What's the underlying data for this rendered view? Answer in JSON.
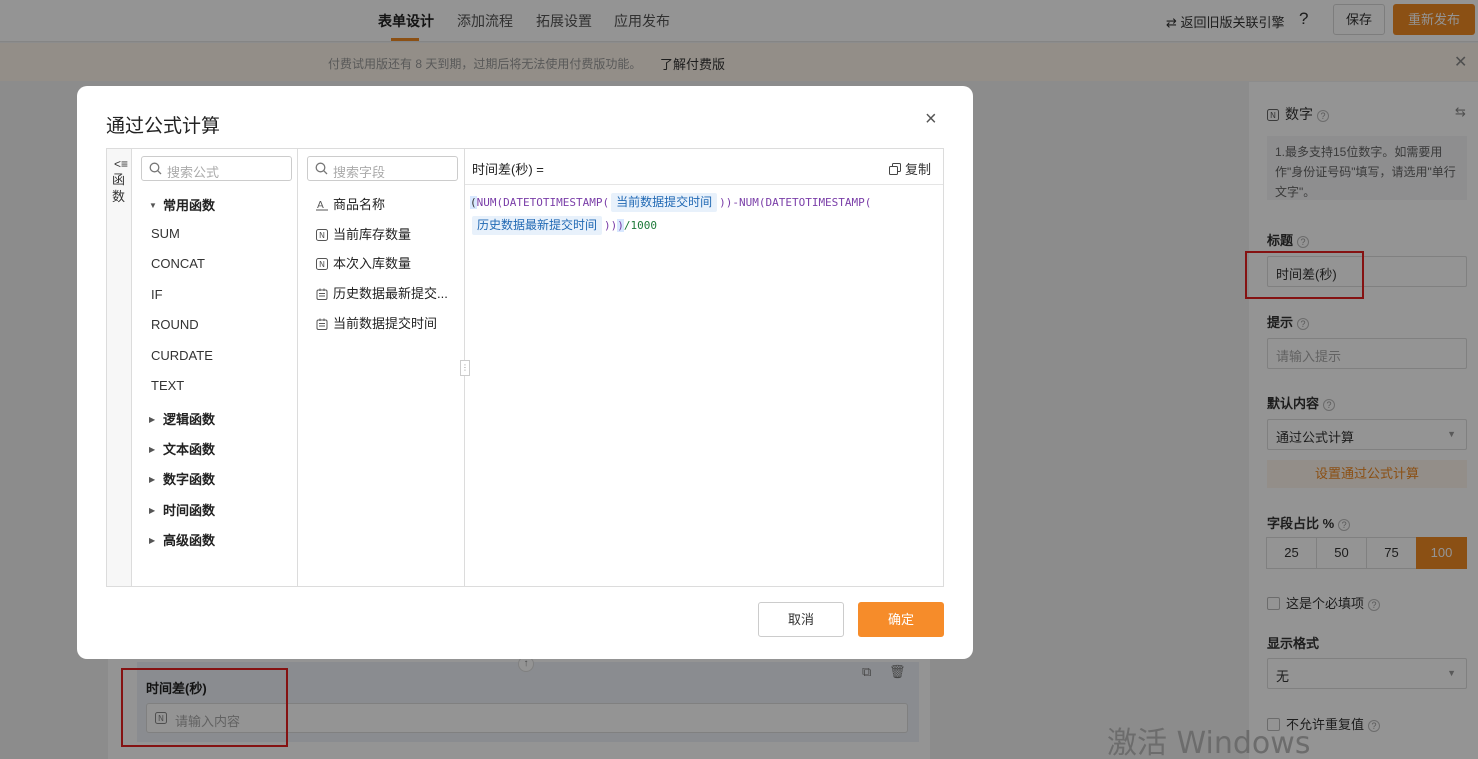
{
  "topbar": {
    "tabs": [
      "表单设计",
      "添加流程",
      "拓展设置",
      "应用发布"
    ],
    "back_link": "⇄ 返回旧版关联引擎",
    "help": "?",
    "save": "保存",
    "publish": "重新发布"
  },
  "banner": {
    "text": "付费试用版还有 8 天到期，过期后将无法使用付费版功能。",
    "link": "了解付费版",
    "close": "✕"
  },
  "canvas": {
    "field_label": "时间差(秒)",
    "field_placeholder": "请输入内容"
  },
  "panel": {
    "type_title": "数字",
    "description": "1.最多支持15位数字。如需要用作\"身份证号码\"填写，请选用\"单行文字\"。",
    "title_label": "标题",
    "title_value": "时间差(秒)",
    "hint_label": "提示",
    "hint_placeholder": "请输入提示",
    "default_label": "默认内容",
    "default_value": "通过公式计算",
    "formula_button": "设置通过公式计算",
    "ratio_label": "字段占比 %",
    "ratio_options": [
      "25",
      "50",
      "75",
      "100"
    ],
    "ratio_selected": "100",
    "required_label": "这是个必填项",
    "format_label": "显示格式",
    "format_value": "无",
    "no_duplicate_label": "不允许重复值"
  },
  "watermark": "激活 Windows",
  "modal": {
    "title": "通过公式计算",
    "close": "×",
    "side_tab": {
      "arrow": "<≡",
      "label": "函数"
    },
    "func_search_placeholder": "搜索公式",
    "field_search_placeholder": "搜索字段",
    "common_group": "常用函数",
    "common_functions": [
      "SUM",
      "CONCAT",
      "IF",
      "ROUND",
      "CURDATE",
      "TEXT"
    ],
    "groups": [
      "逻辑函数",
      "文本函数",
      "数字函数",
      "时间函数",
      "高级函数"
    ],
    "fields": [
      {
        "label": "商品名称",
        "icon": "text-field-icon"
      },
      {
        "label": "当前库存数量",
        "icon": "number-field-icon"
      },
      {
        "label": "本次入库数量",
        "icon": "number-field-icon"
      },
      {
        "label": "历史数据最新提交...",
        "icon": "date-field-icon"
      },
      {
        "label": "当前数据提交时间",
        "icon": "date-field-icon"
      }
    ],
    "editor": {
      "name": "时间差(秒) =",
      "copy": "复制",
      "formula": {
        "open": "(",
        "num1": "NUM(DATETOTIMESTAMP(",
        "chip1": "当前数据提交时间",
        "close1": "))-",
        "num2": "NUM(DATETOTIMESTAMP(",
        "chip2": "历史数据最新提交时间",
        "close2": "))",
        "close3": ")",
        "divisor": "/1000"
      }
    },
    "cancel": "取消",
    "confirm": "确定"
  }
}
